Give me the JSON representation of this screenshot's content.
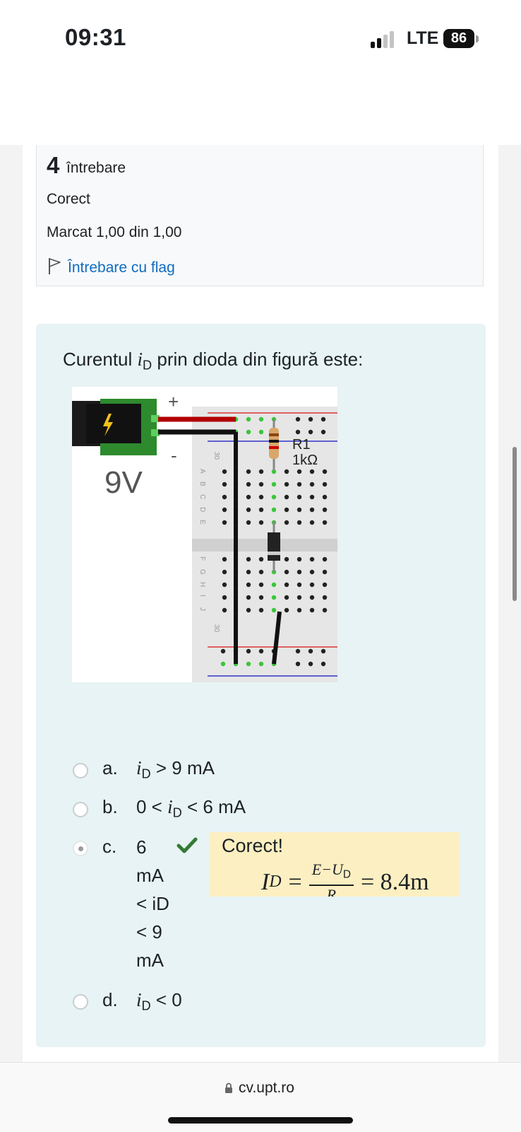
{
  "status_bar": {
    "time": "09:31",
    "network": "LTE",
    "battery": "86"
  },
  "question_info": {
    "number": "4",
    "label": "întrebare",
    "state": "Corect",
    "grade": "Marcat 1,00 din 1,00",
    "flag_label": "Întrebare cu flag"
  },
  "question": {
    "text_before": "Curentul ",
    "symbol": "i",
    "subscript": "D",
    "text_after": " prin dioda din figură este:"
  },
  "circuit": {
    "plus": "+",
    "minus": "-",
    "voltage": "9V",
    "resistor_name": "R1",
    "resistor_value": "1kΩ",
    "row_number": "30",
    "rows_top": [
      "A",
      "B",
      "C",
      "D",
      "E"
    ],
    "rows_bottom": [
      "F",
      "G",
      "H",
      "I",
      "J"
    ]
  },
  "options": [
    {
      "letter": "a.",
      "pre": "",
      "sym": "i",
      "sub": "D",
      "post": " > 9 mA",
      "selected": false
    },
    {
      "letter": "b.",
      "pre": "0 < ",
      "sym": "i",
      "sub": "D",
      "post": " < 6 mA",
      "selected": false
    },
    {
      "letter": "c.",
      "lines": [
        "6",
        "mA",
        "< iD",
        "< 9",
        "mA"
      ],
      "selected": true
    },
    {
      "letter": "d.",
      "pre": "",
      "sym": "i",
      "sub": "D",
      "post": " < 0",
      "selected": false
    }
  ],
  "feedback": {
    "title": "Corect!",
    "lhs": "I",
    "lhs_sub": "D",
    "numerator": "E−U",
    "numerator_sub": "D",
    "denominator": "R",
    "result": "= 8.4m"
  },
  "browser": {
    "url": "cv.upt.ro"
  },
  "colors": {
    "link": "#0f6cbf",
    "panel": "#e7f3f5",
    "feedback": "#fcefc1",
    "correct": "#357a32"
  }
}
